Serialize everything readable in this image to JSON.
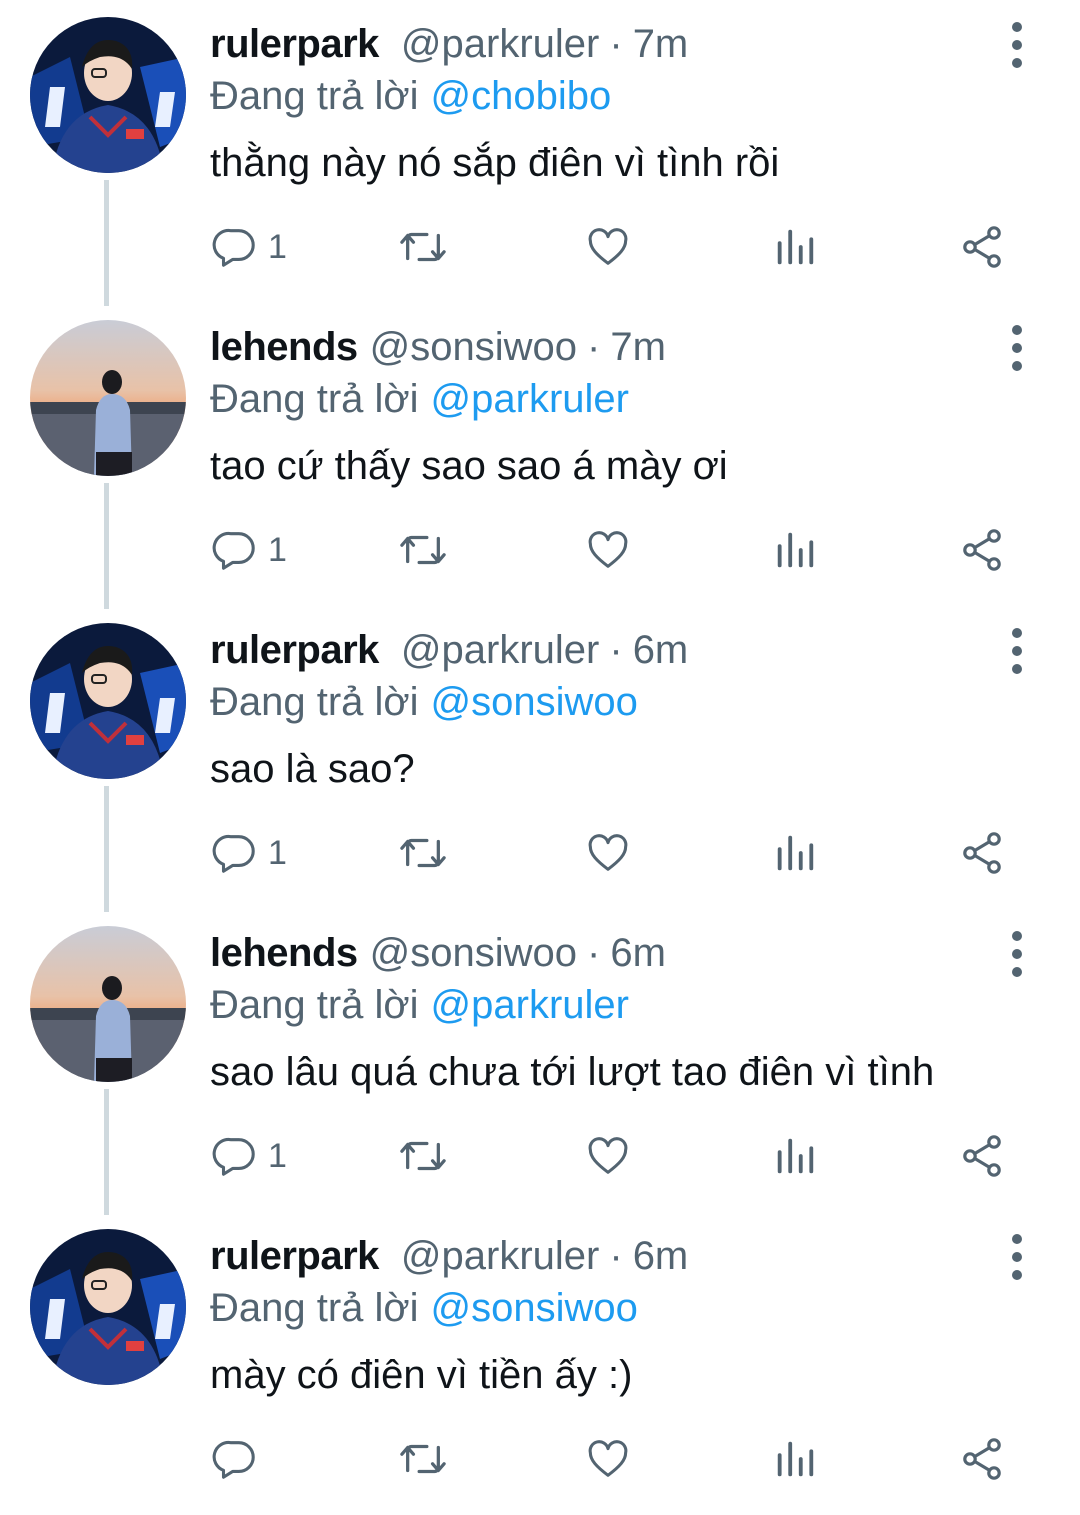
{
  "colors": {
    "text": "#0f1419",
    "secondary": "#536471",
    "mention": "#1d9bf0",
    "thread_line": "#cfd9de",
    "background": "#ffffff"
  },
  "labels": {
    "replying_to": "Đang trả lời",
    "separator": "·"
  },
  "icons": [
    "reply-icon",
    "retweet-icon",
    "like-icon",
    "views-icon",
    "share-icon",
    "more-options-icon"
  ],
  "tweets": [
    {
      "name": "rulerpark",
      "handle": "@parkruler",
      "time": "7m",
      "reply_to": "@chobibo",
      "text": "thằng này nó sắp điên vì tình rồi",
      "reply_count": "1",
      "avatar": "avatar-ruler"
    },
    {
      "name": "lehends",
      "handle": "@sonsiwoo",
      "time": "7m",
      "reply_to": "@parkruler",
      "text": "tao cứ thấy sao sao á mày ơi",
      "reply_count": "1",
      "avatar": "avatar-lehends"
    },
    {
      "name": "rulerpark",
      "handle": "@parkruler",
      "time": "6m",
      "reply_to": "@sonsiwoo",
      "text": "sao là sao?",
      "reply_count": "1",
      "avatar": "avatar-ruler"
    },
    {
      "name": "lehends",
      "handle": "@sonsiwoo",
      "time": "6m",
      "reply_to": "@parkruler",
      "text": "sao lâu quá chưa tới lượt tao điên vì tình",
      "reply_count": "1",
      "avatar": "avatar-lehends"
    },
    {
      "name": "rulerpark",
      "handle": "@parkruler",
      "time": "6m",
      "reply_to": "@sonsiwoo",
      "text": "mày có điên vì tiền ấy :)",
      "reply_count": "",
      "avatar": "avatar-ruler"
    }
  ]
}
